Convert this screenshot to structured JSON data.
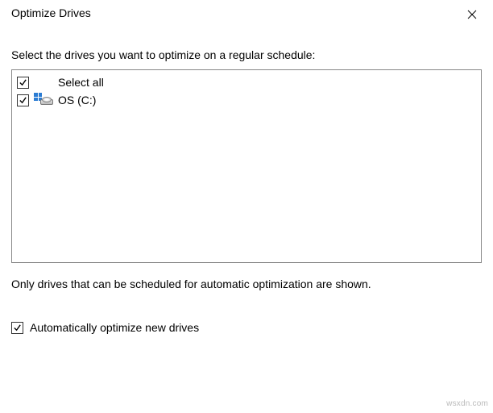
{
  "title": "Optimize Drives",
  "instruction": "Select the drives you want to optimize on a regular schedule:",
  "select_all_label": "Select all",
  "drives": [
    {
      "label": "OS (C:)",
      "checked": true
    }
  ],
  "select_all_checked": true,
  "note": "Only drives that can be scheduled for automatic optimization are shown.",
  "auto_optimize_label": "Automatically optimize new drives",
  "auto_optimize_checked": true,
  "watermark": "wsxdn.com"
}
